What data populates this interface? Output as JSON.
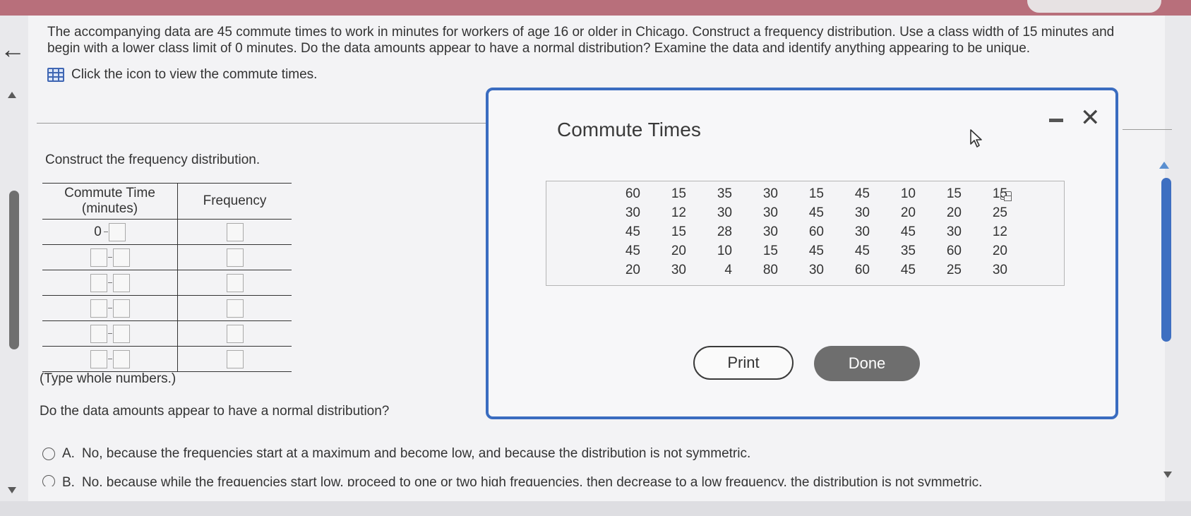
{
  "question": {
    "text": "The accompanying data are 45 commute times to work in minutes for workers of age 16 or older in Chicago. Construct a frequency distribution. Use a class width of 15 minutes and begin with a lower class limit of 0 minutes. Do the data amounts appear to have a normal distribution? Examine the data and identify anything appearing to be unique.",
    "icon_link": "Click the icon to view the commute times.",
    "icon": "table-grid-icon"
  },
  "frequency": {
    "instruction": "Construct the frequency distribution.",
    "headers": [
      "Commute Time (minutes)",
      "Frequency"
    ],
    "first_lower": "0",
    "row_count": 6,
    "note": "(Type whole numbers.)"
  },
  "normal_question": "Do the data amounts appear to have a normal distribution?",
  "options": [
    {
      "letter": "A.",
      "text": "No, because the frequencies start at a maximum and become low, and because the distribution is not symmetric."
    },
    {
      "letter": "B.",
      "text": "No, because while the frequencies start low, proceed to one or two high frequencies, then decrease to a low frequency, the distribution is not symmetric."
    }
  ],
  "modal": {
    "title": "Commute Times",
    "minimize_icon": "minimize-icon",
    "close_icon": "close-icon",
    "rows": [
      [
        "60",
        "15",
        "35",
        "30",
        "15",
        "45",
        "10",
        "15",
        "15"
      ],
      [
        "30",
        "12",
        "30",
        "30",
        "45",
        "30",
        "20",
        "20",
        "25"
      ],
      [
        "45",
        "15",
        "28",
        "30",
        "60",
        "30",
        "45",
        "30",
        "12"
      ],
      [
        "45",
        "20",
        "10",
        "15",
        "45",
        "45",
        "35",
        "60",
        "20"
      ],
      [
        "20",
        "30",
        "4",
        "80",
        "30",
        "60",
        "45",
        "25",
        "30"
      ]
    ],
    "print_label": "Print",
    "done_label": "Done"
  },
  "colors": {
    "modal_border": "#3a6cc0",
    "top_bar": "#b86f7b",
    "done_button": "#6e6e6e"
  }
}
